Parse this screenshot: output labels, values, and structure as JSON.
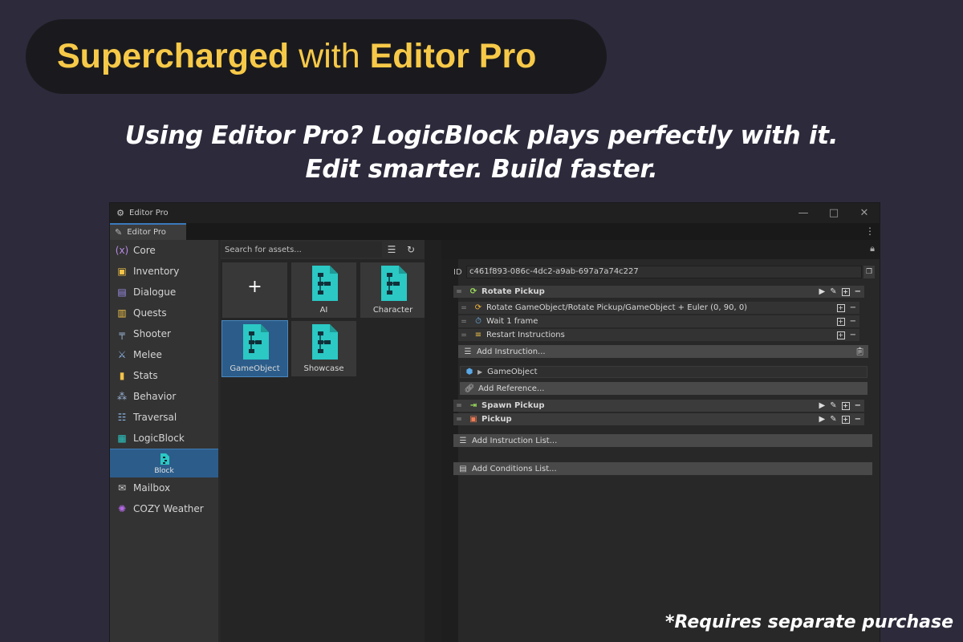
{
  "promo": {
    "headline_part1": "Supercharged",
    "headline_part2": "with",
    "headline_part3": "Editor Pro",
    "tagline_line1": "Using Editor Pro? LogicBlock plays perfectly with it.",
    "tagline_line2": "Edit smarter. Build faster.",
    "footnote": "*Requires separate purchase"
  },
  "window": {
    "title": "Editor Pro",
    "tab_label": "Editor Pro",
    "controls": {
      "minimize": "—",
      "maximize": "□",
      "close": "✕"
    },
    "more_icon": "⋮"
  },
  "sidebar": {
    "items": [
      {
        "label": "Core",
        "icon": "variable-icon",
        "glyph": "(x)",
        "color": "#b88ae6"
      },
      {
        "label": "Inventory",
        "icon": "backpack-icon",
        "glyph": "▣",
        "color": "#f2c34a"
      },
      {
        "label": "Dialogue",
        "icon": "document-icon",
        "glyph": "▤",
        "color": "#9b8ee8"
      },
      {
        "label": "Quests",
        "icon": "scroll-icon",
        "glyph": "▥",
        "color": "#f2c34a"
      },
      {
        "label": "Shooter",
        "icon": "gun-icon",
        "glyph": "╤",
        "color": "#9ab3d6"
      },
      {
        "label": "Melee",
        "icon": "sword-icon",
        "glyph": "⚔",
        "color": "#8cb4e6"
      },
      {
        "label": "Stats",
        "icon": "bar-chart-icon",
        "glyph": "▮",
        "color": "#f2c34a"
      },
      {
        "label": "Behavior",
        "icon": "behavior-tree-icon",
        "glyph": "⁂",
        "color": "#9ab3d6"
      },
      {
        "label": "Traversal",
        "icon": "ladder-icon",
        "glyph": "☷",
        "color": "#8cb4e6"
      },
      {
        "label": "LogicBlock",
        "icon": "logicblock-icon",
        "glyph": "▦",
        "color": "#2bc8c4"
      }
    ],
    "sub_item": {
      "label": "Block",
      "icon": "block-file-icon"
    },
    "items_after": [
      {
        "label": "Mailbox",
        "icon": "mail-icon",
        "glyph": "✉",
        "color": "#cfcfcf"
      },
      {
        "label": "COZY Weather",
        "icon": "sun-icon",
        "glyph": "✺",
        "color": "#b469e6"
      }
    ]
  },
  "assets": {
    "search_placeholder": "Search for assets...",
    "tiles": [
      {
        "label": "",
        "kind": "add"
      },
      {
        "label": "AI",
        "kind": "file"
      },
      {
        "label": "Character",
        "kind": "file"
      },
      {
        "label": "GameObject",
        "kind": "file",
        "selected": true
      },
      {
        "label": "Showcase",
        "kind": "file"
      }
    ],
    "add_glyph": "+"
  },
  "inspector": {
    "id_label": "ID",
    "id_value": "c461f893-086c-4dc2-a9ab-697a7a74c227",
    "group1": {
      "title": "Rotate Pickup",
      "instructions": [
        "Rotate GameObject/Rotate Pickup/GameObject + Euler (0, 90, 0)",
        "Wait 1 frame",
        "Restart Instructions"
      ],
      "add_instruction": "Add Instruction...",
      "reference": "GameObject",
      "add_reference": "Add Reference..."
    },
    "group2_title": "Spawn Pickup",
    "group3_title": "Pickup",
    "add_instruction_list": "Add Instruction List...",
    "add_conditions_list": "Add Conditions List..."
  }
}
